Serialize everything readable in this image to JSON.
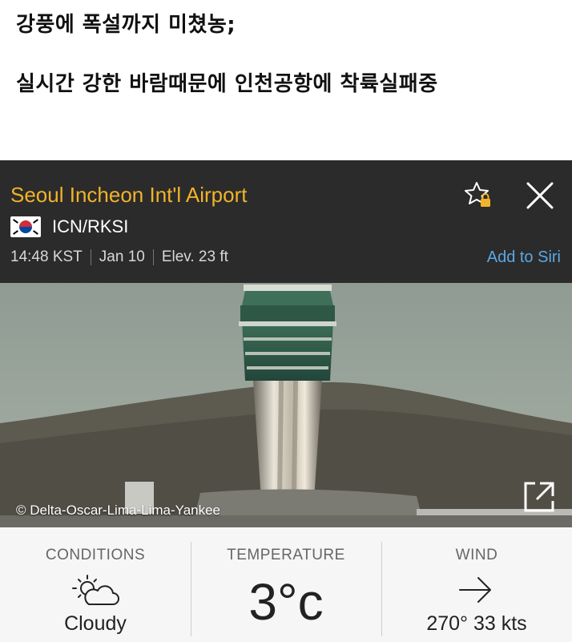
{
  "caption": {
    "line1": "강풍에 폭설까지 미쳤농;",
    "line2": "실시간 강한 바람때문에 인천공항에 착륙실패중"
  },
  "airport": {
    "name": "Seoul Incheon Int'l Airport",
    "code": "ICN/RKSI",
    "time": "14:48 KST",
    "date": "Jan 10",
    "elevation": "Elev. 23 ft",
    "siri_label": "Add to Siri",
    "name_color": "#f1b32b",
    "siri_color": "#5aa8e6"
  },
  "icons": {
    "favorite": "star-lock-icon",
    "close": "close-icon",
    "flag": "south-korea-flag-icon",
    "expand": "expand-icon",
    "conditions": "partly-cloudy-icon",
    "wind": "arrow-right-icon"
  },
  "photo": {
    "credit": "© Delta-Oscar-Lima-Lima-Yankee"
  },
  "stats": {
    "conditions": {
      "label": "CONDITIONS",
      "value": "Cloudy"
    },
    "temperature": {
      "label": "TEMPERATURE",
      "value": "3°c"
    },
    "wind": {
      "label": "WIND",
      "value": "270° 33 kts"
    }
  }
}
